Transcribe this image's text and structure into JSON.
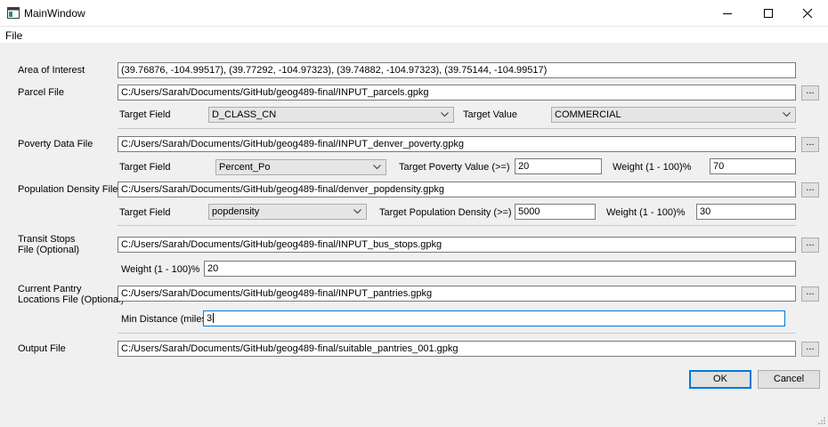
{
  "window": {
    "title": "MainWindow"
  },
  "menu": {
    "file": "File"
  },
  "area_of_interest": {
    "label": "Area of Interest",
    "value": "(39.76876, -104.99517), (39.77292, -104.97323), (39.74882, -104.97323), (39.75144, -104.99517)"
  },
  "parcel": {
    "label": "Parcel File",
    "path": "C:/Users/Sarah/Documents/GitHub/geog489-final/INPUT_parcels.gpkg",
    "browse": "...",
    "target_field_label": "Target Field",
    "target_field": "D_CLASS_CN",
    "target_value_label": "Target Value",
    "target_value": "COMMERCIAL"
  },
  "poverty": {
    "label": "Poverty Data File",
    "path": "C:/Users/Sarah/Documents/GitHub/geog489-final/INPUT_denver_poverty.gpkg",
    "browse": "...",
    "target_field_label": "Target Field",
    "target_field": "Percent_Po",
    "target_value_label": "Target Poverty Value (>=)",
    "target_value": "20",
    "weight_label": "Weight (1 - 100)%",
    "weight": "70"
  },
  "density": {
    "label": "Population Density File",
    "path": "C:/Users/Sarah/Documents/GitHub/geog489-final/denver_popdensity.gpkg",
    "browse": "...",
    "target_field_label": "Target Field",
    "target_field": "popdensity",
    "target_value_label": "Target Population Density (>=)",
    "target_value": "5000",
    "weight_label": "Weight (1 - 100)%",
    "weight": "30"
  },
  "transit": {
    "label_line1": "Transit Stops",
    "label_line2": "File (Optional)",
    "path": "C:/Users/Sarah/Documents/GitHub/geog489-final/INPUT_bus_stops.gpkg",
    "browse": "...",
    "weight_label": "Weight (1 - 100)%",
    "weight": "20"
  },
  "pantry": {
    "label_line1": "Current Pantry",
    "label_line2": "Locations File (Optional)",
    "path": "C:/Users/Sarah/Documents/GitHub/geog489-final/INPUT_pantries.gpkg",
    "browse": "...",
    "min_distance_label": "Min Distance (miles)",
    "min_distance": "3"
  },
  "output": {
    "label": "Output File",
    "path": "C:/Users/Sarah/Documents/GitHub/geog489-final/suitable_pantries_001.gpkg",
    "browse": "..."
  },
  "buttons": {
    "ok": "OK",
    "cancel": "Cancel"
  },
  "colors": {
    "focus_border": "#0078d7",
    "background": "#f0f0f0"
  }
}
